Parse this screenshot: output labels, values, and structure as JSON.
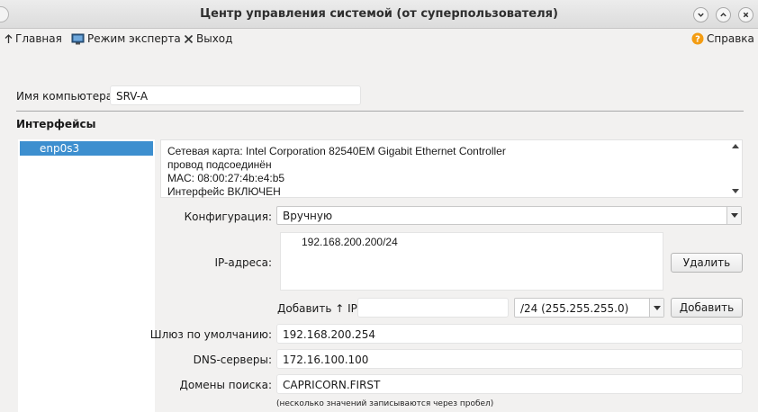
{
  "window": {
    "title": "Центр управления системой (от суперпользователя)"
  },
  "toolbar": {
    "home_label": "Главная",
    "expert_label": "Режим эксперта",
    "exit_label": "Выход",
    "help_label": "Справка"
  },
  "computer": {
    "label": "Имя компьютера:",
    "value": "SRV-A"
  },
  "interfaces": {
    "title": "Интерфейсы",
    "items": [
      "enp0s3"
    ],
    "info_lines": [
      "Сетевая карта: Intel Corporation 82540EM Gigabit Ethernet Controller",
      "провод подсоединён",
      "MAC: 08:00:27:4b:e4:b5",
      "Интерфейс ВКЛЮЧЕН"
    ]
  },
  "config": {
    "label": "Конфигурация:",
    "value": "Вручную"
  },
  "ip": {
    "label": "IP-адреса:",
    "addresses": [
      "192.168.200.200/24"
    ],
    "delete_label": "Удалить",
    "add_ip_label": "Добавить ↑ IP:",
    "add_ip_value": "",
    "mask_value": "/24 (255.255.255.0)",
    "add_button_label": "Добавить"
  },
  "gateway": {
    "label": "Шлюз по умолчанию:",
    "value": "192.168.200.254"
  },
  "dns": {
    "label": "DNS-серверы:",
    "value": "172.16.100.100"
  },
  "domains": {
    "label": "Домены поиска:",
    "value": "CAPRICORN.FIRST",
    "hint": "(несколько значений записываются через пробел)"
  },
  "colors": {
    "selection": "#3d8fcf",
    "help_icon": "#f39c12"
  }
}
